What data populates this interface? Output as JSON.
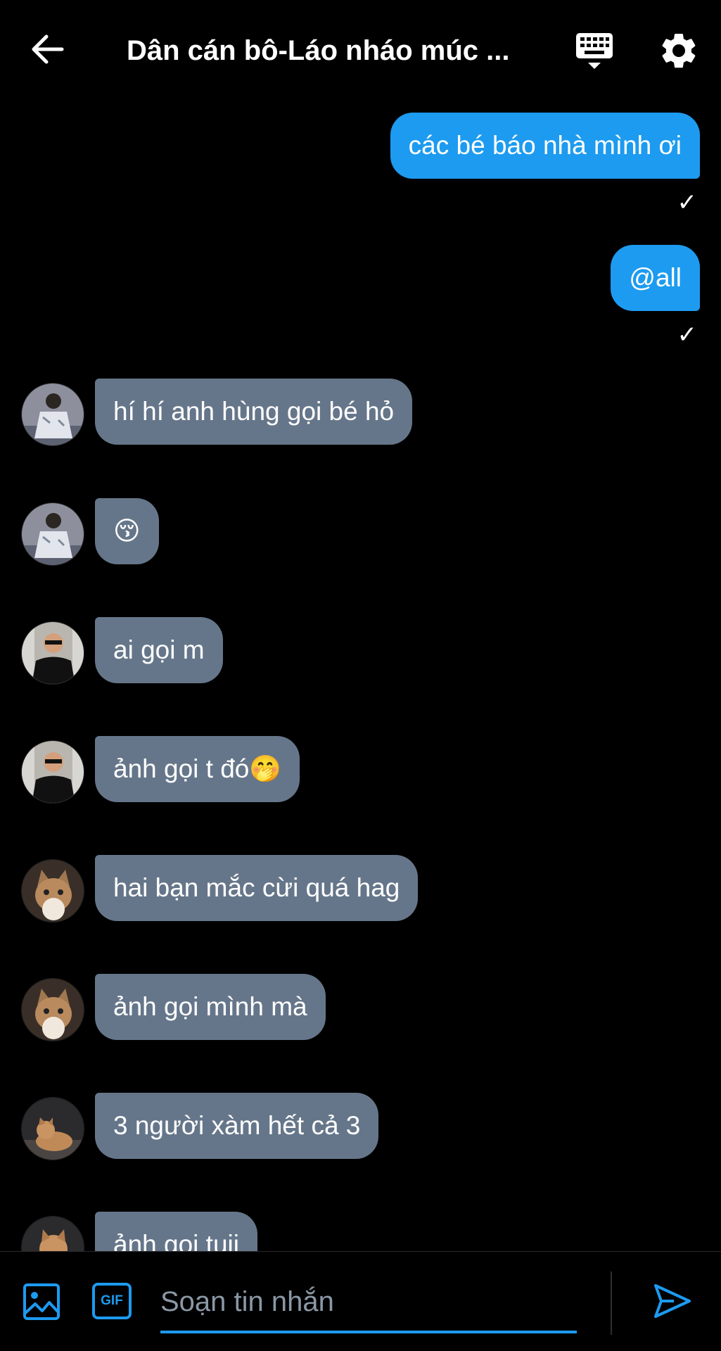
{
  "header": {
    "title": "Dân cán bô-Láo nháo múc ...",
    "back_icon": "arrow-left-icon",
    "keyboard_icon": "keyboard-icon",
    "settings_icon": "gear-icon"
  },
  "messages": [
    {
      "id": 1,
      "direction": "outgoing",
      "text": "các bé báo nhà mình ơi",
      "status": "✓"
    },
    {
      "id": 2,
      "direction": "outgoing",
      "text": "@all",
      "status": "✓"
    },
    {
      "id": 3,
      "direction": "incoming",
      "text": "hí hí anh hùng gọi bé hỏ"
    },
    {
      "id": 4,
      "direction": "incoming",
      "text": "😚"
    },
    {
      "id": 5,
      "direction": "incoming",
      "text": "ai gọi m"
    },
    {
      "id": 6,
      "direction": "incoming",
      "text": "ảnh gọi t đó🤭"
    },
    {
      "id": 7,
      "direction": "incoming",
      "text": "hai bạn mắc cừi quá hag"
    },
    {
      "id": 8,
      "direction": "incoming",
      "text": "ảnh gọi mình mà"
    },
    {
      "id": 9,
      "direction": "incoming",
      "text": "3 người xàm hết cả 3"
    },
    {
      "id": 10,
      "direction": "incoming",
      "text": "ảnh gọi tuii"
    }
  ],
  "composer": {
    "placeholder": "Soạn tin nhắn",
    "gif_label": "GIF",
    "image_icon": "image-icon",
    "send_icon": "send-icon"
  },
  "colors": {
    "background": "#000000",
    "outgoing_bubble": "#1d9bf0",
    "incoming_bubble": "#66768a",
    "accent": "#1d9bf0",
    "placeholder_text": "#8b98a5"
  }
}
